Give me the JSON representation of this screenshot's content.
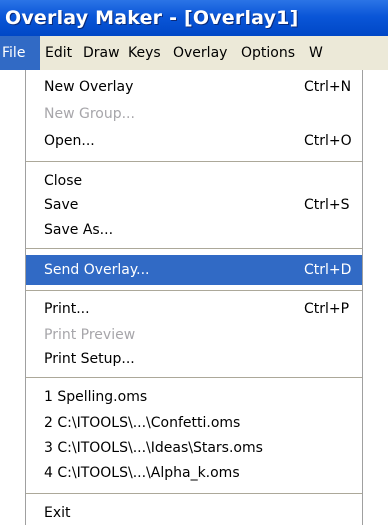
{
  "window": {
    "title": "Overlay Maker - [Overlay1]"
  },
  "menubar": {
    "items": [
      "File",
      "Edit",
      "Draw",
      "Keys",
      "Overlay",
      "Options",
      "W"
    ],
    "active": "File"
  },
  "file_menu": {
    "new_overlay": {
      "label": "New Overlay",
      "shortcut": "Ctrl+N"
    },
    "new_group": {
      "label": "New Group...",
      "enabled": false
    },
    "open": {
      "label": "Open...",
      "shortcut": "Ctrl+O"
    },
    "close": {
      "label": "Close"
    },
    "save": {
      "label": "Save",
      "shortcut": "Ctrl+S"
    },
    "save_as": {
      "label": "Save As..."
    },
    "send_overlay": {
      "label": "Send Overlay...",
      "shortcut": "Ctrl+D",
      "highlighted": true
    },
    "print": {
      "label": "Print...",
      "shortcut": "Ctrl+P"
    },
    "print_preview": {
      "label": "Print Preview",
      "enabled": false
    },
    "print_setup": {
      "label": "Print Setup..."
    },
    "recent": [
      "1 Spelling.oms",
      "2 C:\\ITOOLS\\...\\Confetti.oms",
      "3 C:\\ITOOLS\\...\\Ideas\\Stars.oms",
      "4 C:\\ITOOLS\\...\\Alpha_k.oms"
    ],
    "exit": {
      "label": "Exit"
    }
  },
  "colors": {
    "titlebar": "#0a56d8",
    "menubar": "#ece9d8",
    "highlight": "#316ac5",
    "disabled_text": "#a7a6aa"
  }
}
